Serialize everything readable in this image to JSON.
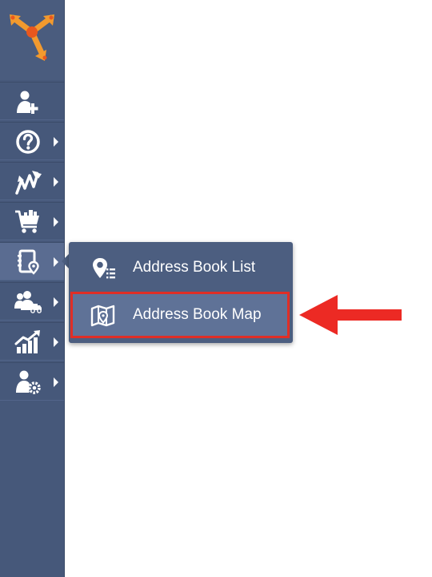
{
  "sidebar": {
    "items": [
      {
        "icon": "add-user-icon",
        "has_submenu": false
      },
      {
        "icon": "help-icon",
        "has_submenu": true
      },
      {
        "icon": "routes-icon",
        "has_submenu": true
      },
      {
        "icon": "orders-cart-icon",
        "has_submenu": true
      },
      {
        "icon": "address-book-icon",
        "has_submenu": true,
        "active": true
      },
      {
        "icon": "team-vehicles-icon",
        "has_submenu": true
      },
      {
        "icon": "analytics-icon",
        "has_submenu": true
      },
      {
        "icon": "user-settings-icon",
        "has_submenu": true
      }
    ]
  },
  "flyout": {
    "items": [
      {
        "label": "Address Book List",
        "icon": "address-list-icon"
      },
      {
        "label": "Address Book Map",
        "icon": "address-map-icon",
        "highlighted": true
      }
    ]
  },
  "colors": {
    "sidebar": "#46587a",
    "flyout": "#4c5e80",
    "highlight_border": "#e02e26",
    "arrow": "#ec2a24",
    "logo_orange": "#f29a2e"
  }
}
